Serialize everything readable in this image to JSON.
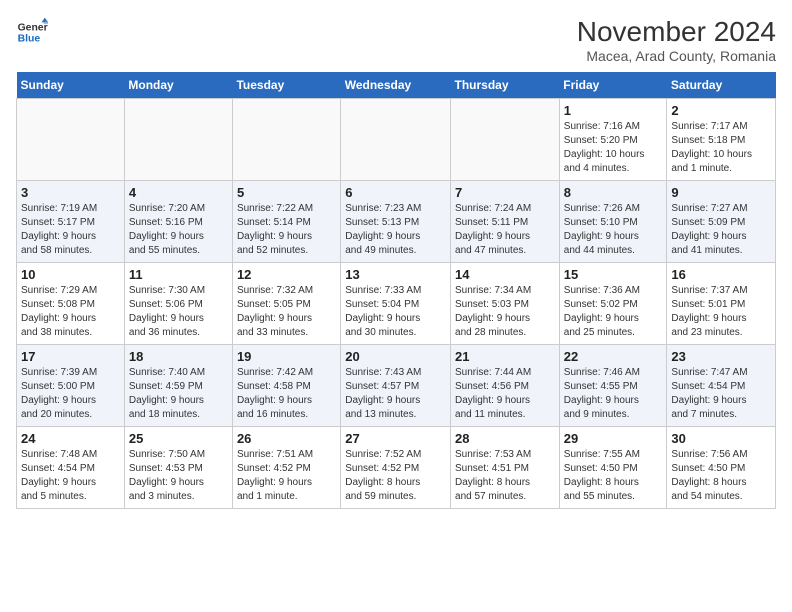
{
  "logo": {
    "line1": "General",
    "line2": "Blue"
  },
  "title": "November 2024",
  "subtitle": "Macea, Arad County, Romania",
  "weekdays": [
    "Sunday",
    "Monday",
    "Tuesday",
    "Wednesday",
    "Thursday",
    "Friday",
    "Saturday"
  ],
  "weeks": [
    [
      {
        "day": "",
        "info": ""
      },
      {
        "day": "",
        "info": ""
      },
      {
        "day": "",
        "info": ""
      },
      {
        "day": "",
        "info": ""
      },
      {
        "day": "",
        "info": ""
      },
      {
        "day": "1",
        "info": "Sunrise: 7:16 AM\nSunset: 5:20 PM\nDaylight: 10 hours\nand 4 minutes."
      },
      {
        "day": "2",
        "info": "Sunrise: 7:17 AM\nSunset: 5:18 PM\nDaylight: 10 hours\nand 1 minute."
      }
    ],
    [
      {
        "day": "3",
        "info": "Sunrise: 7:19 AM\nSunset: 5:17 PM\nDaylight: 9 hours\nand 58 minutes."
      },
      {
        "day": "4",
        "info": "Sunrise: 7:20 AM\nSunset: 5:16 PM\nDaylight: 9 hours\nand 55 minutes."
      },
      {
        "day": "5",
        "info": "Sunrise: 7:22 AM\nSunset: 5:14 PM\nDaylight: 9 hours\nand 52 minutes."
      },
      {
        "day": "6",
        "info": "Sunrise: 7:23 AM\nSunset: 5:13 PM\nDaylight: 9 hours\nand 49 minutes."
      },
      {
        "day": "7",
        "info": "Sunrise: 7:24 AM\nSunset: 5:11 PM\nDaylight: 9 hours\nand 47 minutes."
      },
      {
        "day": "8",
        "info": "Sunrise: 7:26 AM\nSunset: 5:10 PM\nDaylight: 9 hours\nand 44 minutes."
      },
      {
        "day": "9",
        "info": "Sunrise: 7:27 AM\nSunset: 5:09 PM\nDaylight: 9 hours\nand 41 minutes."
      }
    ],
    [
      {
        "day": "10",
        "info": "Sunrise: 7:29 AM\nSunset: 5:08 PM\nDaylight: 9 hours\nand 38 minutes."
      },
      {
        "day": "11",
        "info": "Sunrise: 7:30 AM\nSunset: 5:06 PM\nDaylight: 9 hours\nand 36 minutes."
      },
      {
        "day": "12",
        "info": "Sunrise: 7:32 AM\nSunset: 5:05 PM\nDaylight: 9 hours\nand 33 minutes."
      },
      {
        "day": "13",
        "info": "Sunrise: 7:33 AM\nSunset: 5:04 PM\nDaylight: 9 hours\nand 30 minutes."
      },
      {
        "day": "14",
        "info": "Sunrise: 7:34 AM\nSunset: 5:03 PM\nDaylight: 9 hours\nand 28 minutes."
      },
      {
        "day": "15",
        "info": "Sunrise: 7:36 AM\nSunset: 5:02 PM\nDaylight: 9 hours\nand 25 minutes."
      },
      {
        "day": "16",
        "info": "Sunrise: 7:37 AM\nSunset: 5:01 PM\nDaylight: 9 hours\nand 23 minutes."
      }
    ],
    [
      {
        "day": "17",
        "info": "Sunrise: 7:39 AM\nSunset: 5:00 PM\nDaylight: 9 hours\nand 20 minutes."
      },
      {
        "day": "18",
        "info": "Sunrise: 7:40 AM\nSunset: 4:59 PM\nDaylight: 9 hours\nand 18 minutes."
      },
      {
        "day": "19",
        "info": "Sunrise: 7:42 AM\nSunset: 4:58 PM\nDaylight: 9 hours\nand 16 minutes."
      },
      {
        "day": "20",
        "info": "Sunrise: 7:43 AM\nSunset: 4:57 PM\nDaylight: 9 hours\nand 13 minutes."
      },
      {
        "day": "21",
        "info": "Sunrise: 7:44 AM\nSunset: 4:56 PM\nDaylight: 9 hours\nand 11 minutes."
      },
      {
        "day": "22",
        "info": "Sunrise: 7:46 AM\nSunset: 4:55 PM\nDaylight: 9 hours\nand 9 minutes."
      },
      {
        "day": "23",
        "info": "Sunrise: 7:47 AM\nSunset: 4:54 PM\nDaylight: 9 hours\nand 7 minutes."
      }
    ],
    [
      {
        "day": "24",
        "info": "Sunrise: 7:48 AM\nSunset: 4:54 PM\nDaylight: 9 hours\nand 5 minutes."
      },
      {
        "day": "25",
        "info": "Sunrise: 7:50 AM\nSunset: 4:53 PM\nDaylight: 9 hours\nand 3 minutes."
      },
      {
        "day": "26",
        "info": "Sunrise: 7:51 AM\nSunset: 4:52 PM\nDaylight: 9 hours\nand 1 minute."
      },
      {
        "day": "27",
        "info": "Sunrise: 7:52 AM\nSunset: 4:52 PM\nDaylight: 8 hours\nand 59 minutes."
      },
      {
        "day": "28",
        "info": "Sunrise: 7:53 AM\nSunset: 4:51 PM\nDaylight: 8 hours\nand 57 minutes."
      },
      {
        "day": "29",
        "info": "Sunrise: 7:55 AM\nSunset: 4:50 PM\nDaylight: 8 hours\nand 55 minutes."
      },
      {
        "day": "30",
        "info": "Sunrise: 7:56 AM\nSunset: 4:50 PM\nDaylight: 8 hours\nand 54 minutes."
      }
    ]
  ]
}
